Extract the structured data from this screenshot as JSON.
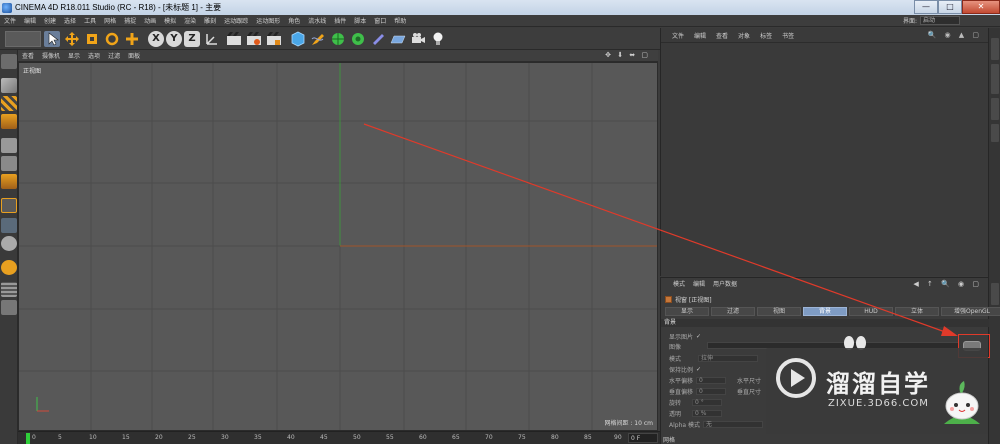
{
  "window": {
    "title": "CINEMA 4D R18.011 Studio (RC - R18) - [未标题 1] - 主要",
    "minimize": "—",
    "maximize": "□",
    "close": "✕"
  },
  "menubar": {
    "items": [
      "文件",
      "编辑",
      "创建",
      "选择",
      "工具",
      "网格",
      "捕捉",
      "动画",
      "模拟",
      "渲染",
      "雕刻",
      "运动跟踪",
      "运动图形",
      "角色",
      "流水线",
      "插件",
      "脚本",
      "窗口",
      "帮助"
    ],
    "layout_label": "界面:",
    "layout_value": "启动"
  },
  "toolbar": {
    "icons": [
      "undo-icon",
      "move-icon",
      "scale-icon",
      "rotate-icon",
      "live-selection-icon",
      "x-axis-icon",
      "y-axis-icon",
      "z-axis-icon",
      "coordinate-system-icon",
      "render-view-icon",
      "render-picture-queue-icon",
      "edit-render-settings-icon",
      "cube-icon",
      "pen-icon",
      "subdivision-icon",
      "cloner-icon",
      "deformer-icon",
      "floor-icon",
      "camera-icon",
      "light-icon"
    ],
    "axis_x": "X",
    "axis_y": "Y",
    "axis_z": "Z"
  },
  "viewport": {
    "menu": [
      "查看",
      "摄像机",
      "显示",
      "选项",
      "过滤",
      "面板"
    ],
    "controls": "✥ ⬇ ⬌ ▢",
    "name": "正视图",
    "grid_info": "网格间距 : 10 cm"
  },
  "timeline": {
    "ticks": [
      "0",
      "5",
      "10",
      "15",
      "20",
      "25",
      "30",
      "35",
      "40",
      "45",
      "50",
      "55",
      "60",
      "65",
      "70",
      "75",
      "80",
      "85",
      "90"
    ],
    "frame": "0 F"
  },
  "object_manager": {
    "menu": [
      "文件",
      "编辑",
      "查看",
      "对象",
      "标签",
      "书签"
    ],
    "icons": "🔍 ◉ ▲ ▢"
  },
  "attribute_manager": {
    "menu": [
      "模式",
      "编辑",
      "用户数据"
    ],
    "nav": "◀ ↑ 🔍 ◉ ▢",
    "title": "视窗 [正视图]",
    "tabs": [
      "显示",
      "过滤",
      "视图",
      "背景",
      "HUD",
      "立体",
      "增强OpenGL"
    ],
    "active_tab": "背景",
    "section": "背景",
    "show_image_label": "显示图片",
    "show_image_check": "✓",
    "image_label": "图像",
    "mode_label": "模式",
    "mode_value": "拉伸",
    "keep_aspect_label": "保持比例",
    "keep_aspect_check": "✓",
    "h_offset_label": "水平偏移",
    "h_offset_value": "0",
    "h_size_label": "水平尺寸",
    "v_offset_label": "垂直偏移",
    "v_offset_value": "0",
    "v_size_label": "垂直尺寸",
    "rotation_label": "旋转",
    "rotation_value": "0 °",
    "transparency_label": "透明",
    "transparency_value": "0 %",
    "alpha_label": "Alpha 模式",
    "alpha_value": "无",
    "footer": "网格"
  },
  "watermark": {
    "brand_cn": "溜溜自学",
    "url": "ZIXUE.3D66.COM"
  },
  "colors": {
    "viewport_bg": "#585858",
    "grid": "#4a4a4a",
    "y_axis": "#3f8f3f",
    "x_axis": "#a0542a",
    "annotation": "#e03a2a",
    "active_tab": "#7f9cc4"
  }
}
